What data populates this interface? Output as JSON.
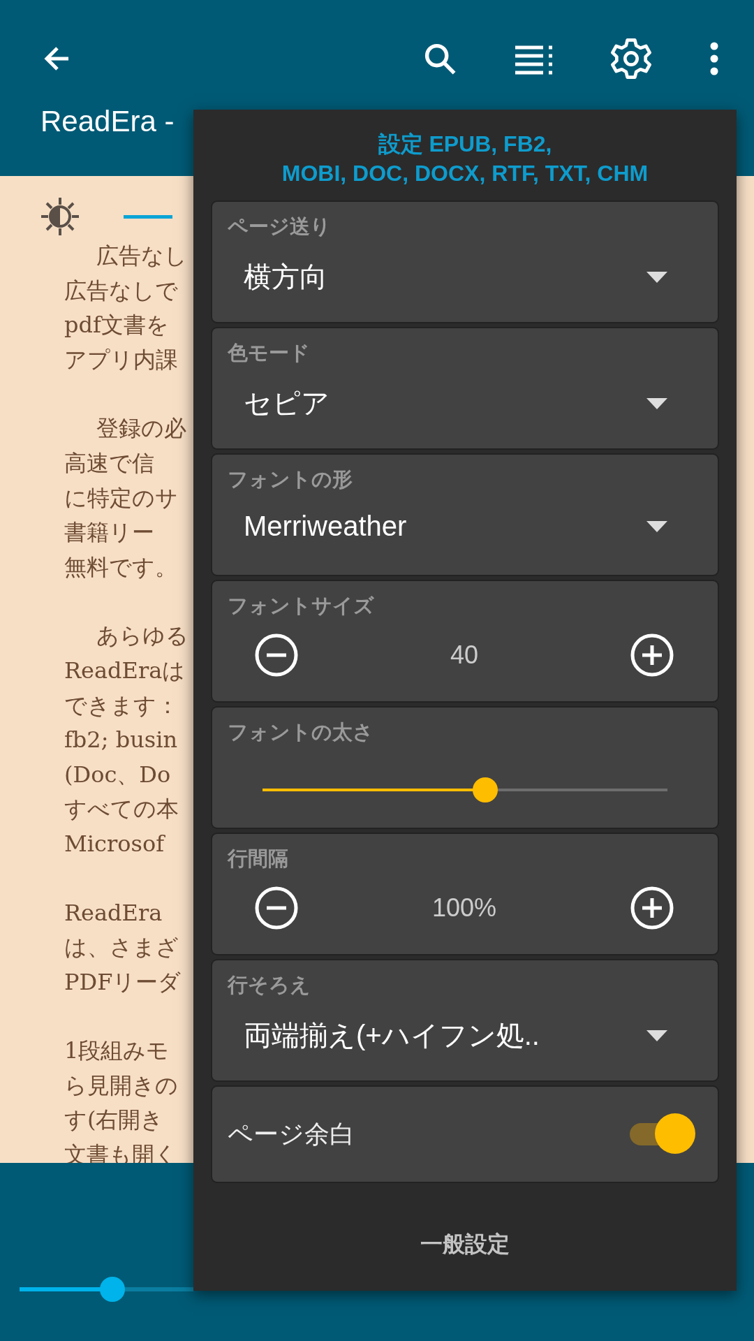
{
  "toolbar": {
    "title": "ReadEra -"
  },
  "book_text": {
    "paragraphs": [
      {
        "lines": [
          "広告なし",
          "広告なしで",
          "pdf文書を",
          "アプリ内課"
        ]
      },
      {
        "lines": [
          "登録の必",
          "高速で信",
          "に特定のサ",
          "書籍リー",
          "無料です。"
        ]
      },
      {
        "lines": [
          "あらゆる",
          "ReadEraは",
          "できます：",
          "fb2; busin",
          "(Doc、Do",
          "すべての本",
          "Microsof"
        ]
      },
      {
        "lines": [
          "ReadEra",
          "は、さまざ",
          "PDFリーダ"
        ]
      },
      {
        "lines": [
          "1段組みモ",
          "ら見開きの",
          "す(右開き",
          "文書も開く"
        ]
      }
    ]
  },
  "settings_panel": {
    "title_lines": [
      "設定 EPUB, FB2,",
      "MOBI, DOC, DOCX, RTF, TXT, CHM"
    ],
    "items": [
      {
        "kind": "dropdown",
        "label": "ページ送り",
        "value": "横方向"
      },
      {
        "kind": "dropdown",
        "label": "色モード",
        "value": "セピア"
      },
      {
        "kind": "dropdown",
        "label": "フォントの形",
        "value": "Merriweather"
      },
      {
        "kind": "stepper",
        "label": "フォントサイズ",
        "value": "40"
      },
      {
        "kind": "slider",
        "label": "フォントの太さ",
        "level": 0.55
      },
      {
        "kind": "stepper",
        "label": "行間隔",
        "value": "100%"
      },
      {
        "kind": "dropdown",
        "label": "行そろえ",
        "value": "両端揃え(+ハイフン処.."
      },
      {
        "kind": "toggle",
        "label": "ページ余白",
        "on": true
      }
    ],
    "footer_link": "一般設定"
  },
  "page_slider": {
    "level": 0.13
  }
}
